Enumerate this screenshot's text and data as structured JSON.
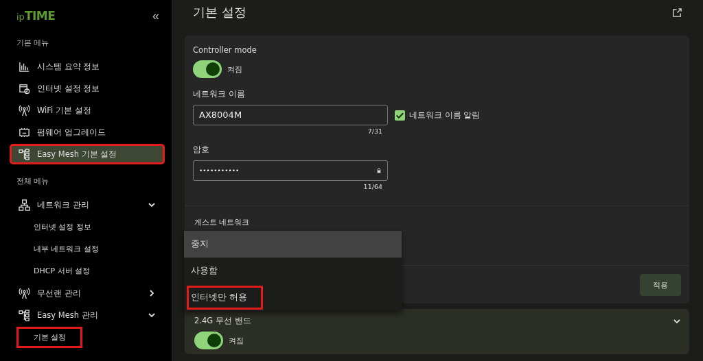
{
  "sidebar": {
    "logo": {
      "prefix": "ip",
      "name": "TIME"
    },
    "collapse": "«",
    "sections": [
      {
        "title": "기본 메뉴",
        "items": [
          {
            "label": "시스템 요약 정보",
            "selected": false,
            "highlighted": false
          },
          {
            "label": "인터넷 설정 정보",
            "selected": false,
            "highlighted": false
          },
          {
            "label": "WiFi 기본 설정",
            "selected": false,
            "highlighted": false
          },
          {
            "label": "펌웨어 업그레이드",
            "selected": false,
            "highlighted": false
          },
          {
            "label": "Easy Mesh 기본 설정",
            "selected": true,
            "highlighted": true
          }
        ]
      },
      {
        "title": "전체 메뉴",
        "items": [
          {
            "label": "네트워크 관리",
            "expanded": true,
            "selected": false,
            "highlighted": false,
            "children": [
              {
                "label": "인터넷 설정 정보",
                "selected": false,
                "highlighted": false
              },
              {
                "label": "내부 네트워크 설정",
                "selected": false,
                "highlighted": false
              },
              {
                "label": "DHCP 서버 설정",
                "selected": false,
                "highlighted": false
              }
            ]
          },
          {
            "label": "무선랜 관리",
            "expanded": false,
            "selected": false,
            "highlighted": false
          },
          {
            "label": "Easy Mesh 관리",
            "expanded": true,
            "selected": false,
            "highlighted": false,
            "children": [
              {
                "label": "기본 설정",
                "selected": false,
                "highlighted": true
              }
            ]
          }
        ]
      }
    ]
  },
  "page": {
    "title": "기본 설정"
  },
  "settings": {
    "controller": {
      "label": "Controller mode",
      "on": true,
      "state": "켜짐"
    },
    "network_name": {
      "label": "네트워크 이름",
      "value": "AX8004M",
      "counter": "7/31",
      "broadcast": {
        "label": "네트워크 이름 알림",
        "checked": true
      }
    },
    "password": {
      "label": "암호",
      "value": "•••••••••••",
      "counter": "11/64"
    },
    "guest": {
      "label": "게스트 네트워크"
    },
    "apply": "적용"
  },
  "dropdown": {
    "options": [
      {
        "label": "중지",
        "selected": true,
        "highlighted": false
      },
      {
        "label": "사용함",
        "selected": false,
        "highlighted": false
      },
      {
        "label": "인터넷만 허용",
        "selected": false,
        "highlighted": true
      }
    ]
  },
  "band": {
    "label": "2.4G 무선 밴드",
    "on": true,
    "state": "켜짐",
    "expanded": false
  }
}
